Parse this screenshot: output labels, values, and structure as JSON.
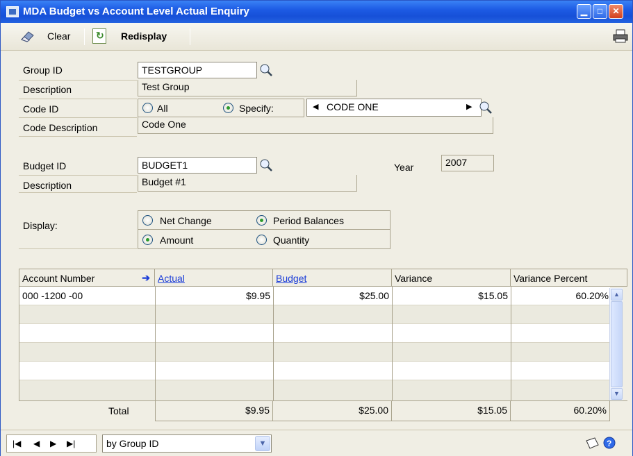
{
  "window": {
    "title": "MDA Budget vs Account Level Actual Enquiry"
  },
  "toolbar": {
    "clear_label": "Clear",
    "redisplay_label": "Redisplay"
  },
  "form": {
    "group_id_label": "Group ID",
    "group_id_value": "TESTGROUP",
    "group_desc_label": "Description",
    "group_desc_value": "Test Group",
    "code_id_label": "Code ID",
    "code_all_label": "All",
    "code_specify_label": "Specify:",
    "code_value": "CODE ONE",
    "code_desc_label": "Code Description",
    "code_desc_value": "Code One",
    "budget_id_label": "Budget ID",
    "budget_id_value": "BUDGET1",
    "year_label": "Year",
    "year_value": "2007",
    "budget_desc_label": "Description",
    "budget_desc_value": "Budget #1",
    "display_label": "Display:",
    "net_change_label": "Net Change",
    "period_balances_label": "Period Balances",
    "amount_label": "Amount",
    "quantity_label": "Quantity"
  },
  "grid": {
    "headers": {
      "account": "Account Number",
      "actual": "Actual",
      "budget": "Budget",
      "variance": "Variance",
      "variance_pct": "Variance Percent"
    },
    "rows": [
      {
        "account": "000 -1200 -00",
        "actual": "$9.95",
        "budget": "$25.00",
        "variance": "$15.05",
        "variance_pct": "60.20%"
      }
    ],
    "totals": {
      "label": "Total",
      "actual": "$9.95",
      "budget": "$25.00",
      "variance": "$15.05",
      "variance_pct": "60.20%"
    }
  },
  "bottom": {
    "sort_value": "by Group ID"
  },
  "colors": {
    "title_bar": "#1d5be4",
    "window_bg": "#f0eee4",
    "link": "#1a3cd8",
    "alt_row": "#ebeadf"
  }
}
